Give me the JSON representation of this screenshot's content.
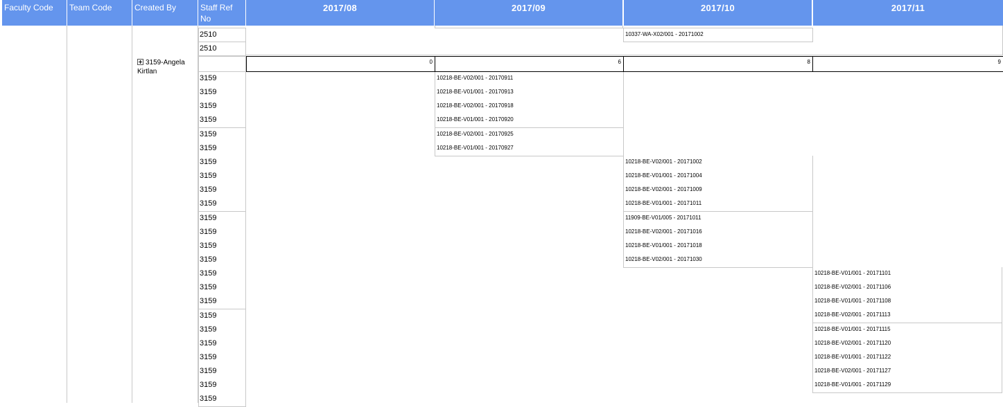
{
  "headers": {
    "faculty_code": "Faculty Code",
    "team_code": "Team Code",
    "created_by": "Created By",
    "staff_ref_line1": "Staff Ref",
    "staff_ref_line2": "No",
    "months": [
      "2017/08",
      "2017/09",
      "2017/10",
      "2017/11"
    ]
  },
  "group_prev": {
    "staff_refs": [
      "2510",
      "2510"
    ],
    "oct_entry": "10337-WA-X02/001 - 20171002"
  },
  "group": {
    "creator_line1": "3159-Angela",
    "creator_line2": "Kirtlan",
    "counts": [
      "0",
      "6",
      "8",
      "9"
    ],
    "staff_refs": [
      "3159",
      "3159",
      "3159",
      "3159",
      "3159",
      "3159",
      "3159",
      "3159",
      "3159",
      "3159",
      "3159",
      "3159",
      "3159",
      "3159",
      "3159",
      "3159",
      "3159",
      "3159",
      "3159",
      "3159",
      "3159",
      "3159",
      "3159",
      "3159"
    ],
    "sep_entries": [
      "10218-BE-V02/001 - 20170911",
      "10218-BE-V01/001 - 20170913",
      "10218-BE-V02/001 - 20170918",
      "10218-BE-V01/001 - 20170920",
      "10218-BE-V02/001 - 20170925",
      "10218-BE-V01/001 - 20170927"
    ],
    "oct_entries": [
      "10218-BE-V02/001 - 20171002",
      "10218-BE-V01/001 - 20171004",
      "10218-BE-V02/001 - 20171009",
      "10218-BE-V01/001 - 20171011",
      "11909-BE-V01/005 - 20171011",
      "10218-BE-V02/001 - 20171016",
      "10218-BE-V01/001 - 20171018",
      "10218-BE-V02/001 - 20171030"
    ],
    "nov_entries": [
      "10218-BE-V01/001 - 20171101",
      "10218-BE-V02/001 - 20171106",
      "10218-BE-V01/001 - 20171108",
      "10218-BE-V02/001 - 20171113",
      "10218-BE-V01/001 - 20171115",
      "10218-BE-V02/001 - 20171120",
      "10218-BE-V01/001 - 20171122",
      "10218-BE-V02/001 - 20171127",
      "10218-BE-V01/001 - 20171129"
    ]
  }
}
